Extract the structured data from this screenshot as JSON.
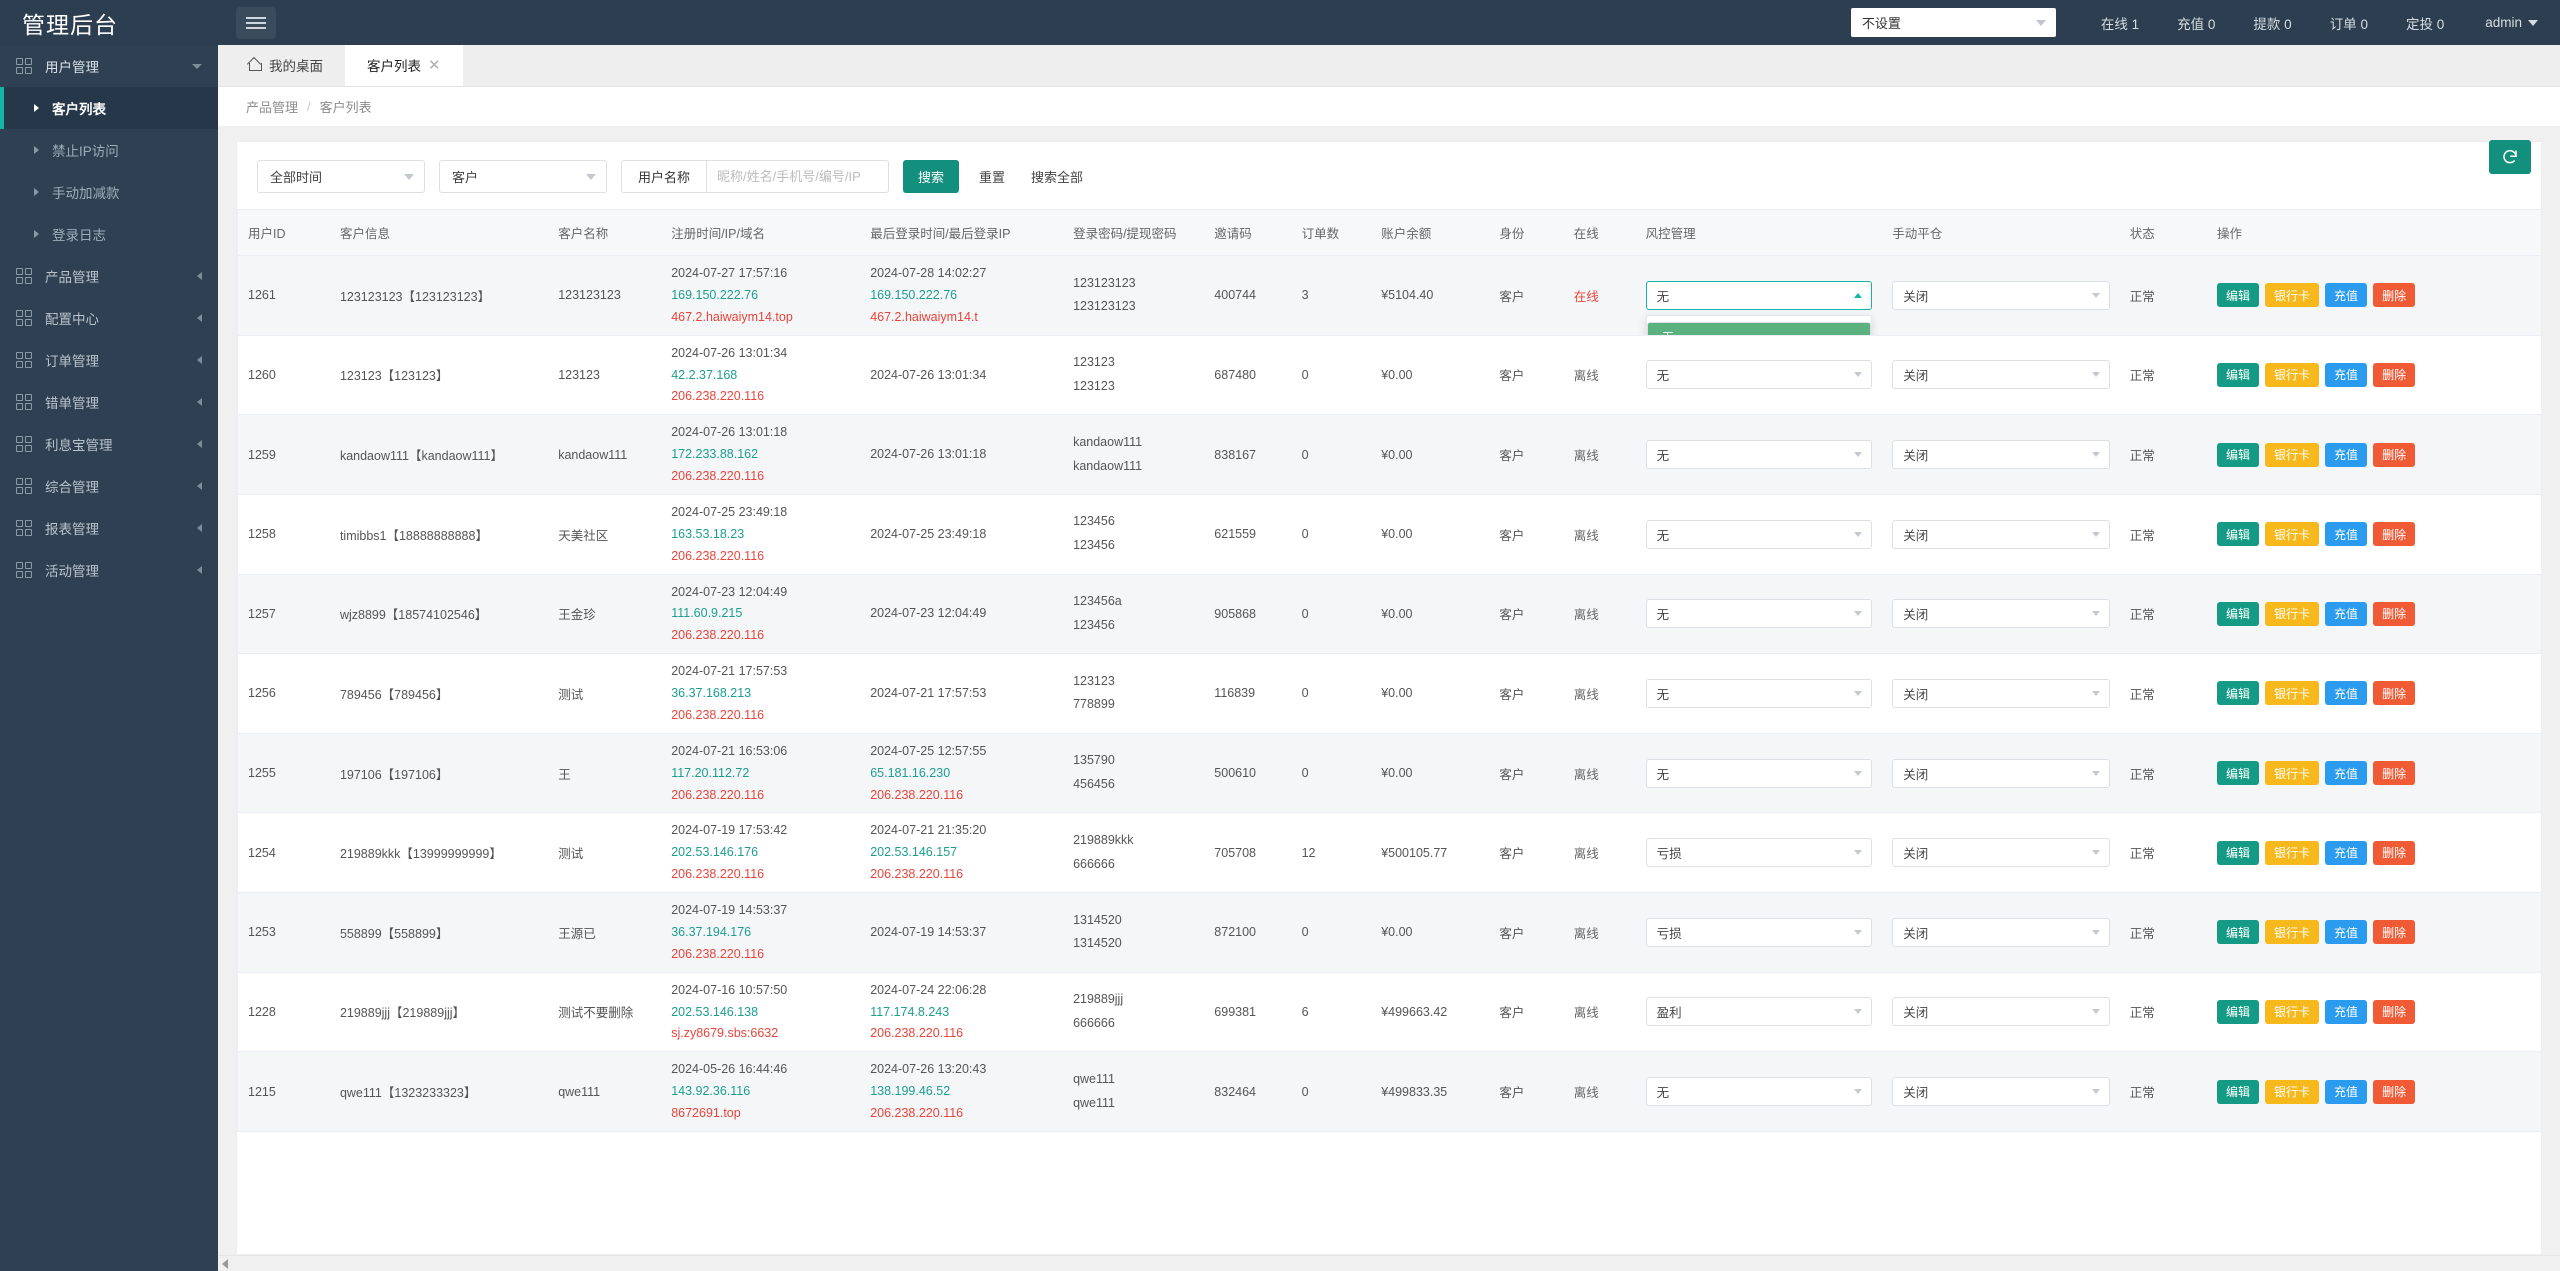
{
  "app": {
    "brand": "管理后台",
    "menu_toggle_icon": "hamburger-icon"
  },
  "header": {
    "site_select_value": "不设置",
    "stats": [
      {
        "label": "在线 1"
      },
      {
        "label": "充值 0"
      },
      {
        "label": "提款 0"
      },
      {
        "label": "订单 0"
      },
      {
        "label": "定投 0"
      }
    ],
    "user": "admin"
  },
  "sidebar": {
    "groups": [
      {
        "label": "用户管理",
        "expanded": true,
        "children": [
          {
            "label": "客户列表",
            "active": true
          },
          {
            "label": "禁止IP访问",
            "active": false
          },
          {
            "label": "手动加减款",
            "active": false
          },
          {
            "label": "登录日志",
            "active": false
          }
        ]
      },
      {
        "label": "产品管理",
        "expanded": false,
        "children": []
      },
      {
        "label": "配置中心",
        "expanded": false,
        "children": []
      },
      {
        "label": "订单管理",
        "expanded": false,
        "children": []
      },
      {
        "label": "错单管理",
        "expanded": false,
        "children": []
      },
      {
        "label": "利息宝管理",
        "expanded": false,
        "children": []
      },
      {
        "label": "综合管理",
        "expanded": false,
        "children": []
      },
      {
        "label": "报表管理",
        "expanded": false,
        "children": []
      },
      {
        "label": "活动管理",
        "expanded": false,
        "children": []
      }
    ]
  },
  "tabs": [
    {
      "label": "我的桌面",
      "active": false,
      "closable": false,
      "icon": "home-icon"
    },
    {
      "label": "客户列表",
      "active": true,
      "closable": true
    }
  ],
  "breadcrumb": {
    "parent": "产品管理",
    "separator": "/",
    "current": "客户列表"
  },
  "toolbar": {
    "refresh_icon": "refresh-icon",
    "time_select": "全部时间",
    "role_select": "客户",
    "field_label": "用户名称",
    "keyword_value": "",
    "keyword_placeholder": "昵称/姓名/手机号/编号/IP",
    "search_button": "搜索",
    "reset_link": "重置",
    "search_all_link": "搜索全部"
  },
  "table": {
    "columns": [
      "用户ID",
      "客户信息",
      "客户名称",
      "注册时间/IP/域名",
      "最后登录时间/最后登录IP",
      "登录密码/提现密码",
      "邀请码",
      "订单数",
      "账户余额",
      "身份",
      "在线",
      "风控管理",
      "手动平仓",
      "状态",
      "操作"
    ],
    "risk_options": [
      "无",
      "盈利",
      "亏损"
    ],
    "close_option": "关闭",
    "open_dropdown_row_index": 0,
    "op_buttons": [
      "编辑",
      "银行卡",
      "充值",
      "删除"
    ],
    "rows": [
      {
        "id": "1261",
        "info": "123123123【123123123】",
        "name": "123123123",
        "reg_time": "2024-07-27 17:57:16",
        "reg_ip": "169.150.222.76",
        "reg_domain": "467.2.haiwaiym14.top",
        "last_time": "2024-07-28 14:02:27",
        "last_ip": "169.150.222.76",
        "last_domain": "467.2.haiwaiym14.t",
        "pwd_login": "123123123",
        "pwd_withdraw": "123123123",
        "invite": "400744",
        "orders": "3",
        "balance": "¥5104.40",
        "identity": "客户",
        "online": "在线",
        "online_flag": true,
        "risk": "无",
        "manual": "关闭",
        "status": "正常"
      },
      {
        "id": "1260",
        "info": "123123【123123】",
        "name": "123123",
        "reg_time": "2024-07-26 13:01:34",
        "reg_ip": "42.2.37.168",
        "reg_domain": "206.238.220.116",
        "last_time": "2024-07-26 13:01:34",
        "last_ip": "",
        "last_domain": "",
        "pwd_login": "123123",
        "pwd_withdraw": "123123",
        "invite": "687480",
        "orders": "0",
        "balance": "¥0.00",
        "identity": "客户",
        "online": "离线",
        "online_flag": false,
        "risk": "无",
        "manual": "关闭",
        "status": "正常"
      },
      {
        "id": "1259",
        "info": "kandaow111【kandaow111】",
        "name": "kandaow111",
        "reg_time": "2024-07-26 13:01:18",
        "reg_ip": "172.233.88.162",
        "reg_domain": "206.238.220.116",
        "last_time": "2024-07-26 13:01:18",
        "last_ip": "",
        "last_domain": "",
        "pwd_login": "kandaow111",
        "pwd_withdraw": "kandaow111",
        "invite": "838167",
        "orders": "0",
        "balance": "¥0.00",
        "identity": "客户",
        "online": "离线",
        "online_flag": false,
        "risk": "无",
        "manual": "关闭",
        "status": "正常"
      },
      {
        "id": "1258",
        "info": "timibbs1【18888888888】",
        "name": "天美社区",
        "reg_time": "2024-07-25 23:49:18",
        "reg_ip": "163.53.18.23",
        "reg_domain": "206.238.220.116",
        "last_time": "2024-07-25 23:49:18",
        "last_ip": "",
        "last_domain": "",
        "pwd_login": "123456",
        "pwd_withdraw": "123456",
        "invite": "621559",
        "orders": "0",
        "balance": "¥0.00",
        "identity": "客户",
        "online": "离线",
        "online_flag": false,
        "risk": "无",
        "manual": "关闭",
        "status": "正常"
      },
      {
        "id": "1257",
        "info": "wjz8899【18574102546】",
        "name": "王金珍",
        "reg_time": "2024-07-23 12:04:49",
        "reg_ip": "111.60.9.215",
        "reg_domain": "206.238.220.116",
        "last_time": "2024-07-23 12:04:49",
        "last_ip": "",
        "last_domain": "",
        "pwd_login": "123456a",
        "pwd_withdraw": "123456",
        "invite": "905868",
        "orders": "0",
        "balance": "¥0.00",
        "identity": "客户",
        "online": "离线",
        "online_flag": false,
        "risk": "无",
        "manual": "关闭",
        "status": "正常"
      },
      {
        "id": "1256",
        "info": "789456【789456】",
        "name": "测试",
        "reg_time": "2024-07-21 17:57:53",
        "reg_ip": "36.37.168.213",
        "reg_domain": "206.238.220.116",
        "last_time": "2024-07-21 17:57:53",
        "last_ip": "",
        "last_domain": "",
        "pwd_login": "123123",
        "pwd_withdraw": "778899",
        "invite": "116839",
        "orders": "0",
        "balance": "¥0.00",
        "identity": "客户",
        "online": "离线",
        "online_flag": false,
        "risk": "无",
        "manual": "关闭",
        "status": "正常"
      },
      {
        "id": "1255",
        "info": "197106【197106】",
        "name": "王",
        "reg_time": "2024-07-21 16:53:06",
        "reg_ip": "117.20.112.72",
        "reg_domain": "206.238.220.116",
        "last_time": "2024-07-25 12:57:55",
        "last_ip": "65.181.16.230",
        "last_domain": "206.238.220.116",
        "pwd_login": "135790",
        "pwd_withdraw": "456456",
        "invite": "500610",
        "orders": "0",
        "balance": "¥0.00",
        "identity": "客户",
        "online": "离线",
        "online_flag": false,
        "risk": "无",
        "manual": "关闭",
        "status": "正常"
      },
      {
        "id": "1254",
        "info": "219889kkk【13999999999】",
        "name": "测试",
        "reg_time": "2024-07-19 17:53:42",
        "reg_ip": "202.53.146.176",
        "reg_domain": "206.238.220.116",
        "last_time": "2024-07-21 21:35:20",
        "last_ip": "202.53.146.157",
        "last_domain": "206.238.220.116",
        "pwd_login": "219889kkk",
        "pwd_withdraw": "666666",
        "invite": "705708",
        "orders": "12",
        "balance": "¥500105.77",
        "identity": "客户",
        "online": "离线",
        "online_flag": false,
        "risk": "亏损",
        "manual": "关闭",
        "status": "正常"
      },
      {
        "id": "1253",
        "info": "558899【558899】",
        "name": "王源已",
        "reg_time": "2024-07-19 14:53:37",
        "reg_ip": "36.37.194.176",
        "reg_domain": "206.238.220.116",
        "last_time": "2024-07-19 14:53:37",
        "last_ip": "",
        "last_domain": "",
        "pwd_login": "1314520",
        "pwd_withdraw": "1314520",
        "invite": "872100",
        "orders": "0",
        "balance": "¥0.00",
        "identity": "客户",
        "online": "离线",
        "online_flag": false,
        "risk": "亏损",
        "manual": "关闭",
        "status": "正常"
      },
      {
        "id": "1228",
        "info": "219889jjj【219889jjj】",
        "name": "测试不要删除",
        "reg_time": "2024-07-16 10:57:50",
        "reg_ip": "202.53.146.138",
        "reg_domain": "sj.zy8679.sbs:6632",
        "last_time": "2024-07-24 22:06:28",
        "last_ip": "117.174.8.243",
        "last_domain": "206.238.220.116",
        "pwd_login": "219889jjj",
        "pwd_withdraw": "666666",
        "invite": "699381",
        "orders": "6",
        "balance": "¥499663.42",
        "identity": "客户",
        "online": "离线",
        "online_flag": false,
        "risk": "盈利",
        "manual": "关闭",
        "status": "正常"
      },
      {
        "id": "1215",
        "info": "qwe111【1323233323】",
        "name": "qwe111",
        "reg_time": "2024-05-26 16:44:46",
        "reg_ip": "143.92.36.116",
        "reg_domain": "8672691.top",
        "last_time": "2024-07-26 13:20:43",
        "last_ip": "138.199.46.52",
        "last_domain": "206.238.220.116",
        "pwd_login": "qwe111",
        "pwd_withdraw": "qwe111",
        "invite": "832464",
        "orders": "0",
        "balance": "¥499833.35",
        "identity": "客户",
        "online": "离线",
        "online_flag": false,
        "risk": "无",
        "manual": "关闭",
        "status": "正常"
      }
    ]
  },
  "colors": {
    "brand_dark": "#2c3e50",
    "sidebar": "#2e4052",
    "accent_teal": "#138f7d",
    "active_bar": "#13b5a5",
    "ip_green": "#1b9e8f",
    "domain_red": "#e8443a",
    "dd_selected_green": "#5cb27e",
    "btn_edit": "#159a86",
    "btn_bank": "#f6b81a",
    "btn_topup": "#2b9bf0",
    "btn_delete": "#f05a35"
  }
}
